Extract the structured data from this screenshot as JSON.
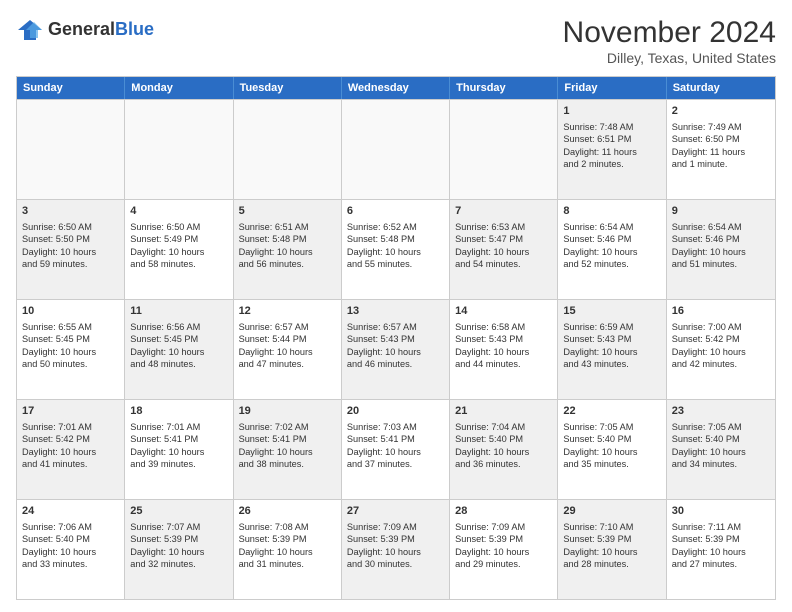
{
  "header": {
    "logo_line1": "General",
    "logo_line2": "Blue",
    "month_title": "November 2024",
    "location": "Dilley, Texas, United States"
  },
  "days_of_week": [
    "Sunday",
    "Monday",
    "Tuesday",
    "Wednesday",
    "Thursday",
    "Friday",
    "Saturday"
  ],
  "rows": [
    [
      {
        "day": "",
        "data": "",
        "empty": true
      },
      {
        "day": "",
        "data": "",
        "empty": true
      },
      {
        "day": "",
        "data": "",
        "empty": true
      },
      {
        "day": "",
        "data": "",
        "empty": true
      },
      {
        "day": "",
        "data": "",
        "empty": true
      },
      {
        "day": "1",
        "data": "Sunrise: 7:48 AM\nSunset: 6:51 PM\nDaylight: 11 hours\nand 2 minutes.",
        "shaded": true
      },
      {
        "day": "2",
        "data": "Sunrise: 7:49 AM\nSunset: 6:50 PM\nDaylight: 11 hours\nand 1 minute.",
        "shaded": false
      }
    ],
    [
      {
        "day": "3",
        "data": "Sunrise: 6:50 AM\nSunset: 5:50 PM\nDaylight: 10 hours\nand 59 minutes.",
        "shaded": true
      },
      {
        "day": "4",
        "data": "Sunrise: 6:50 AM\nSunset: 5:49 PM\nDaylight: 10 hours\nand 58 minutes.",
        "shaded": false
      },
      {
        "day": "5",
        "data": "Sunrise: 6:51 AM\nSunset: 5:48 PM\nDaylight: 10 hours\nand 56 minutes.",
        "shaded": true
      },
      {
        "day": "6",
        "data": "Sunrise: 6:52 AM\nSunset: 5:48 PM\nDaylight: 10 hours\nand 55 minutes.",
        "shaded": false
      },
      {
        "day": "7",
        "data": "Sunrise: 6:53 AM\nSunset: 5:47 PM\nDaylight: 10 hours\nand 54 minutes.",
        "shaded": true
      },
      {
        "day": "8",
        "data": "Sunrise: 6:54 AM\nSunset: 5:46 PM\nDaylight: 10 hours\nand 52 minutes.",
        "shaded": false
      },
      {
        "day": "9",
        "data": "Sunrise: 6:54 AM\nSunset: 5:46 PM\nDaylight: 10 hours\nand 51 minutes.",
        "shaded": true
      }
    ],
    [
      {
        "day": "10",
        "data": "Sunrise: 6:55 AM\nSunset: 5:45 PM\nDaylight: 10 hours\nand 50 minutes.",
        "shaded": false
      },
      {
        "day": "11",
        "data": "Sunrise: 6:56 AM\nSunset: 5:45 PM\nDaylight: 10 hours\nand 48 minutes.",
        "shaded": true
      },
      {
        "day": "12",
        "data": "Sunrise: 6:57 AM\nSunset: 5:44 PM\nDaylight: 10 hours\nand 47 minutes.",
        "shaded": false
      },
      {
        "day": "13",
        "data": "Sunrise: 6:57 AM\nSunset: 5:43 PM\nDaylight: 10 hours\nand 46 minutes.",
        "shaded": true
      },
      {
        "day": "14",
        "data": "Sunrise: 6:58 AM\nSunset: 5:43 PM\nDaylight: 10 hours\nand 44 minutes.",
        "shaded": false
      },
      {
        "day": "15",
        "data": "Sunrise: 6:59 AM\nSunset: 5:43 PM\nDaylight: 10 hours\nand 43 minutes.",
        "shaded": true
      },
      {
        "day": "16",
        "data": "Sunrise: 7:00 AM\nSunset: 5:42 PM\nDaylight: 10 hours\nand 42 minutes.",
        "shaded": false
      }
    ],
    [
      {
        "day": "17",
        "data": "Sunrise: 7:01 AM\nSunset: 5:42 PM\nDaylight: 10 hours\nand 41 minutes.",
        "shaded": true
      },
      {
        "day": "18",
        "data": "Sunrise: 7:01 AM\nSunset: 5:41 PM\nDaylight: 10 hours\nand 39 minutes.",
        "shaded": false
      },
      {
        "day": "19",
        "data": "Sunrise: 7:02 AM\nSunset: 5:41 PM\nDaylight: 10 hours\nand 38 minutes.",
        "shaded": true
      },
      {
        "day": "20",
        "data": "Sunrise: 7:03 AM\nSunset: 5:41 PM\nDaylight: 10 hours\nand 37 minutes.",
        "shaded": false
      },
      {
        "day": "21",
        "data": "Sunrise: 7:04 AM\nSunset: 5:40 PM\nDaylight: 10 hours\nand 36 minutes.",
        "shaded": true
      },
      {
        "day": "22",
        "data": "Sunrise: 7:05 AM\nSunset: 5:40 PM\nDaylight: 10 hours\nand 35 minutes.",
        "shaded": false
      },
      {
        "day": "23",
        "data": "Sunrise: 7:05 AM\nSunset: 5:40 PM\nDaylight: 10 hours\nand 34 minutes.",
        "shaded": true
      }
    ],
    [
      {
        "day": "24",
        "data": "Sunrise: 7:06 AM\nSunset: 5:40 PM\nDaylight: 10 hours\nand 33 minutes.",
        "shaded": false
      },
      {
        "day": "25",
        "data": "Sunrise: 7:07 AM\nSunset: 5:39 PM\nDaylight: 10 hours\nand 32 minutes.",
        "shaded": true
      },
      {
        "day": "26",
        "data": "Sunrise: 7:08 AM\nSunset: 5:39 PM\nDaylight: 10 hours\nand 31 minutes.",
        "shaded": false
      },
      {
        "day": "27",
        "data": "Sunrise: 7:09 AM\nSunset: 5:39 PM\nDaylight: 10 hours\nand 30 minutes.",
        "shaded": true
      },
      {
        "day": "28",
        "data": "Sunrise: 7:09 AM\nSunset: 5:39 PM\nDaylight: 10 hours\nand 29 minutes.",
        "shaded": false
      },
      {
        "day": "29",
        "data": "Sunrise: 7:10 AM\nSunset: 5:39 PM\nDaylight: 10 hours\nand 28 minutes.",
        "shaded": true
      },
      {
        "day": "30",
        "data": "Sunrise: 7:11 AM\nSunset: 5:39 PM\nDaylight: 10 hours\nand 27 minutes.",
        "shaded": false
      }
    ]
  ]
}
